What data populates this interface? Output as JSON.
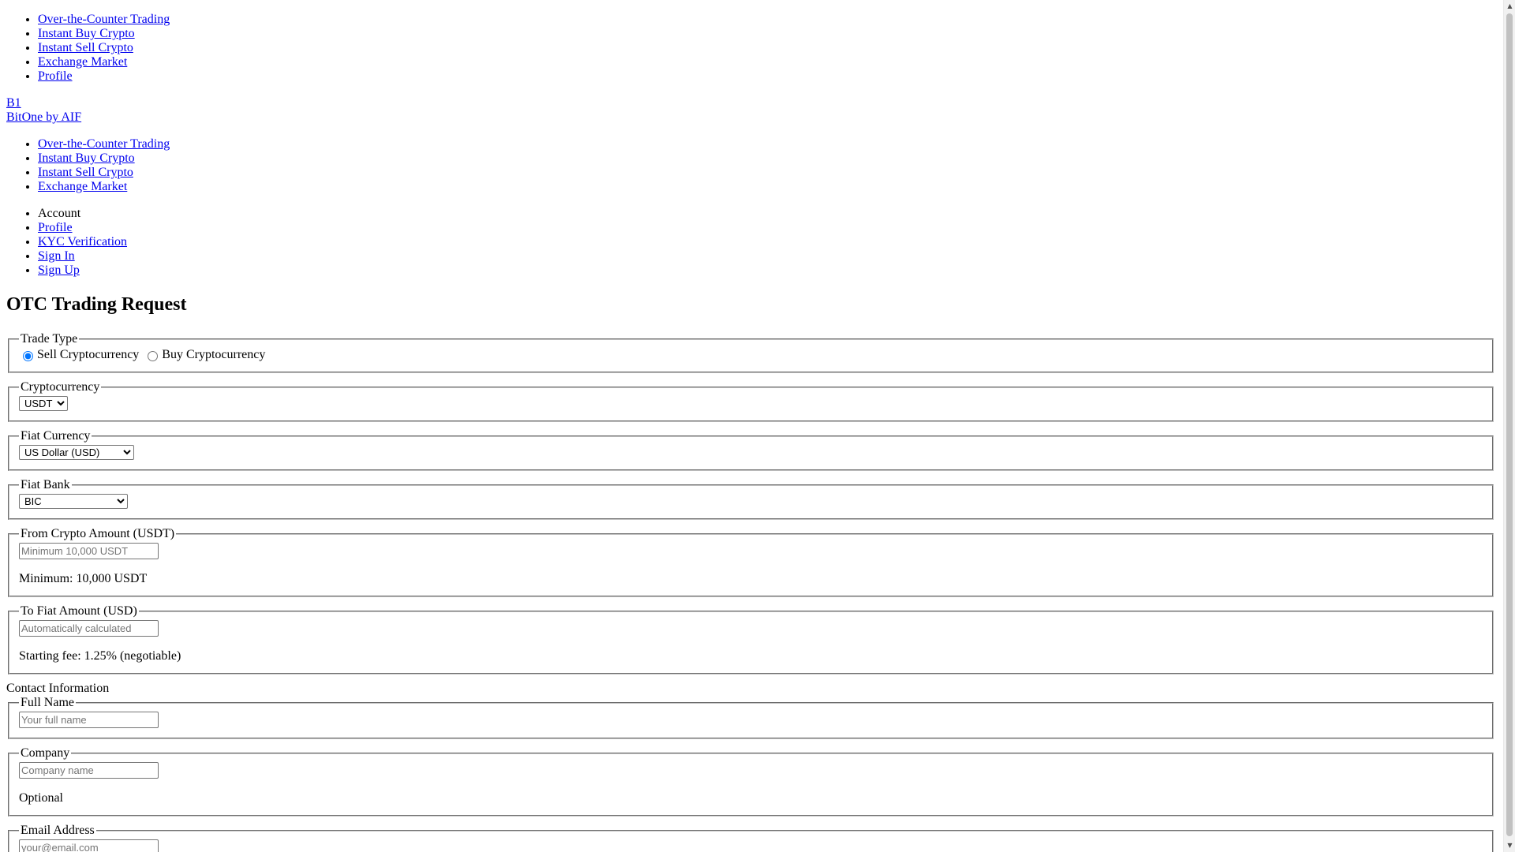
{
  "top_nav": [
    {
      "label": "Over-the-Counter Trading"
    },
    {
      "label": "Instant Buy Crypto"
    },
    {
      "label": "Instant Sell Crypto"
    },
    {
      "label": "Exchange Market"
    },
    {
      "label": "Profile"
    }
  ],
  "brand": {
    "short": "B1",
    "name": "BitOne by AIF"
  },
  "main_nav": [
    {
      "label": "Over-the-Counter Trading"
    },
    {
      "label": "Instant Buy Crypto"
    },
    {
      "label": "Instant Sell Crypto"
    },
    {
      "label": "Exchange Market"
    }
  ],
  "account_menu": {
    "heading": "Account",
    "items": [
      {
        "label": "Profile"
      },
      {
        "label": "KYC Verification"
      },
      {
        "label": "Sign In"
      },
      {
        "label": "Sign Up"
      }
    ]
  },
  "form": {
    "title": "OTC Trading Request",
    "trade_type": {
      "legend": "Trade Type",
      "options": [
        {
          "label": "Sell Cryptocurrency",
          "checked": true
        },
        {
          "label": "Buy Cryptocurrency",
          "checked": false
        }
      ]
    },
    "cryptocurrency": {
      "legend": "Cryptocurrency",
      "selected": "USDT"
    },
    "fiat_currency": {
      "legend": "Fiat Currency",
      "selected": "US Dollar (USD)"
    },
    "fiat_bank": {
      "legend": "Fiat Bank",
      "selected": "BIC"
    },
    "from_amount": {
      "legend": "From Crypto Amount (USDT)",
      "placeholder": "Minimum 10,000 USDT",
      "value": "",
      "help": "Minimum: 10,000 USDT"
    },
    "to_amount": {
      "legend": "To Fiat Amount (USD)",
      "placeholder": "Automatically calculated",
      "value": "",
      "help": "Starting fee: 1.25% (negotiable)"
    },
    "contact_heading": "Contact Information",
    "full_name": {
      "legend": "Full Name",
      "placeholder": "Your full name",
      "value": ""
    },
    "company": {
      "legend": "Company",
      "placeholder": "Company name",
      "value": "",
      "help": "Optional"
    },
    "email": {
      "legend": "Email Address",
      "placeholder": "your@email.com",
      "value": ""
    }
  },
  "colors": {
    "link": "#0000ee",
    "text": "#000000",
    "background": "#ffffff"
  },
  "icons": {
    "scroll_up": "triangle-up",
    "scroll_down": "triangle-down"
  }
}
